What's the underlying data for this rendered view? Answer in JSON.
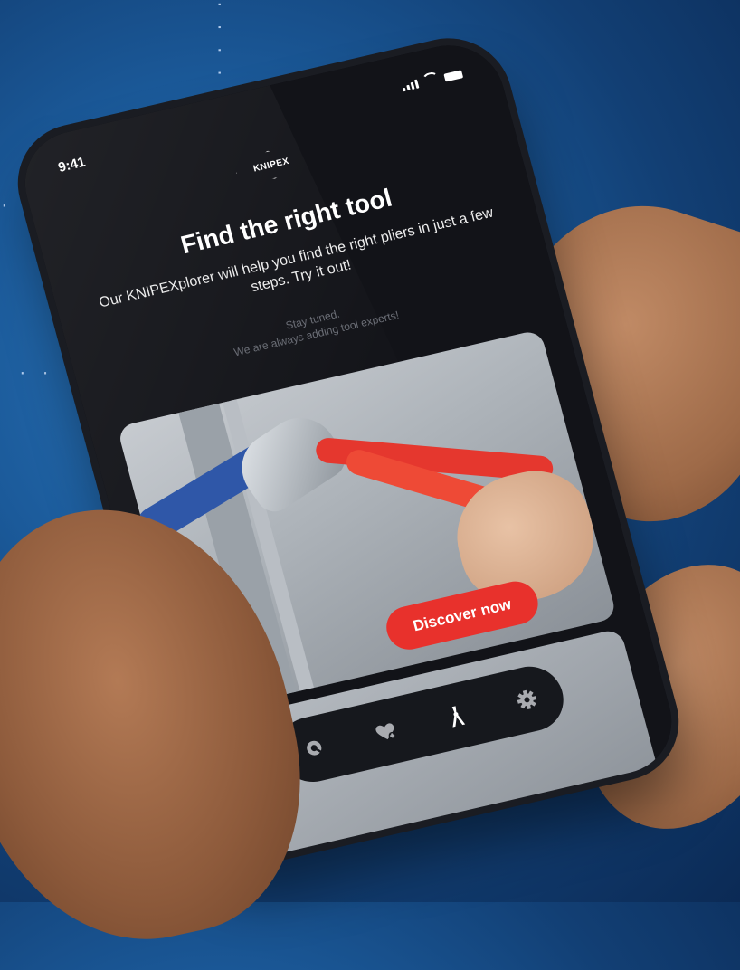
{
  "status_bar": {
    "time": "9:41"
  },
  "brand": {
    "logo_text": "KNIPEX"
  },
  "intro": {
    "title": "Find the right tool",
    "subtitle": "Our KNIPEXplorer will help you find the right pliers in just a few steps. Try it out!",
    "note_line1": "Stay tuned.",
    "note_line2": "We are always adding tool experts!"
  },
  "hero_card": {
    "cta_label": "Discover now"
  },
  "tab_bar": {
    "items": [
      {
        "icon": "search-icon",
        "active": false
      },
      {
        "icon": "heart-plus-icon",
        "active": false
      },
      {
        "icon": "pliers-icon",
        "active": true
      },
      {
        "icon": "gear-icon",
        "active": false
      }
    ]
  },
  "colors": {
    "accent": "#e8312c",
    "background": "#121318",
    "tab_bar": "#16181d",
    "icon_inactive": "#a9abb0",
    "icon_active": "#ffffff"
  }
}
